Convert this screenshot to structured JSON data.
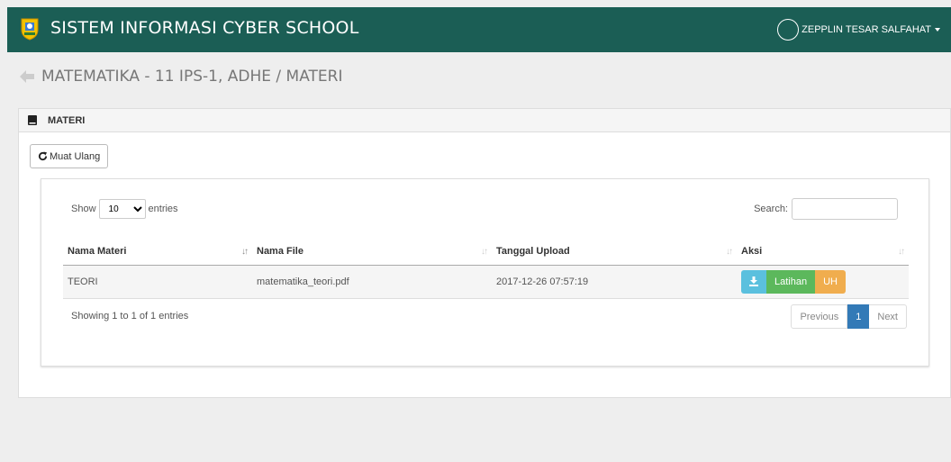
{
  "header": {
    "app_title": "SISTEM INFORMASI CYBER SCHOOL",
    "user_name": "ZEPPLIN TESAR SALFAHAT",
    "brand_color": "#1b5e55"
  },
  "breadcrumb": {
    "text": "MATEMATIKA - 11 IPS-1, ADHE / MATERI"
  },
  "panel": {
    "title": "MATERI",
    "reload_label": "Muat Ulang"
  },
  "table_controls": {
    "show_label": "Show",
    "entries_label": "entries",
    "page_length": "10",
    "search_label": "Search:",
    "search_value": ""
  },
  "table": {
    "columns": [
      "Nama Materi",
      "Nama File",
      "Tanggal Upload",
      "Aksi"
    ],
    "rows": [
      {
        "nama_materi": "TEORI",
        "nama_file": "matematika_teori.pdf",
        "tanggal_upload": "2017-12-26 07:57:19",
        "actions": {
          "download_icon": "download-icon",
          "latihan": "Latihan",
          "uh": "UH"
        }
      }
    ]
  },
  "footer": {
    "info": "Showing 1 to 1 of 1 entries",
    "previous": "Previous",
    "current_page": "1",
    "next": "Next"
  }
}
